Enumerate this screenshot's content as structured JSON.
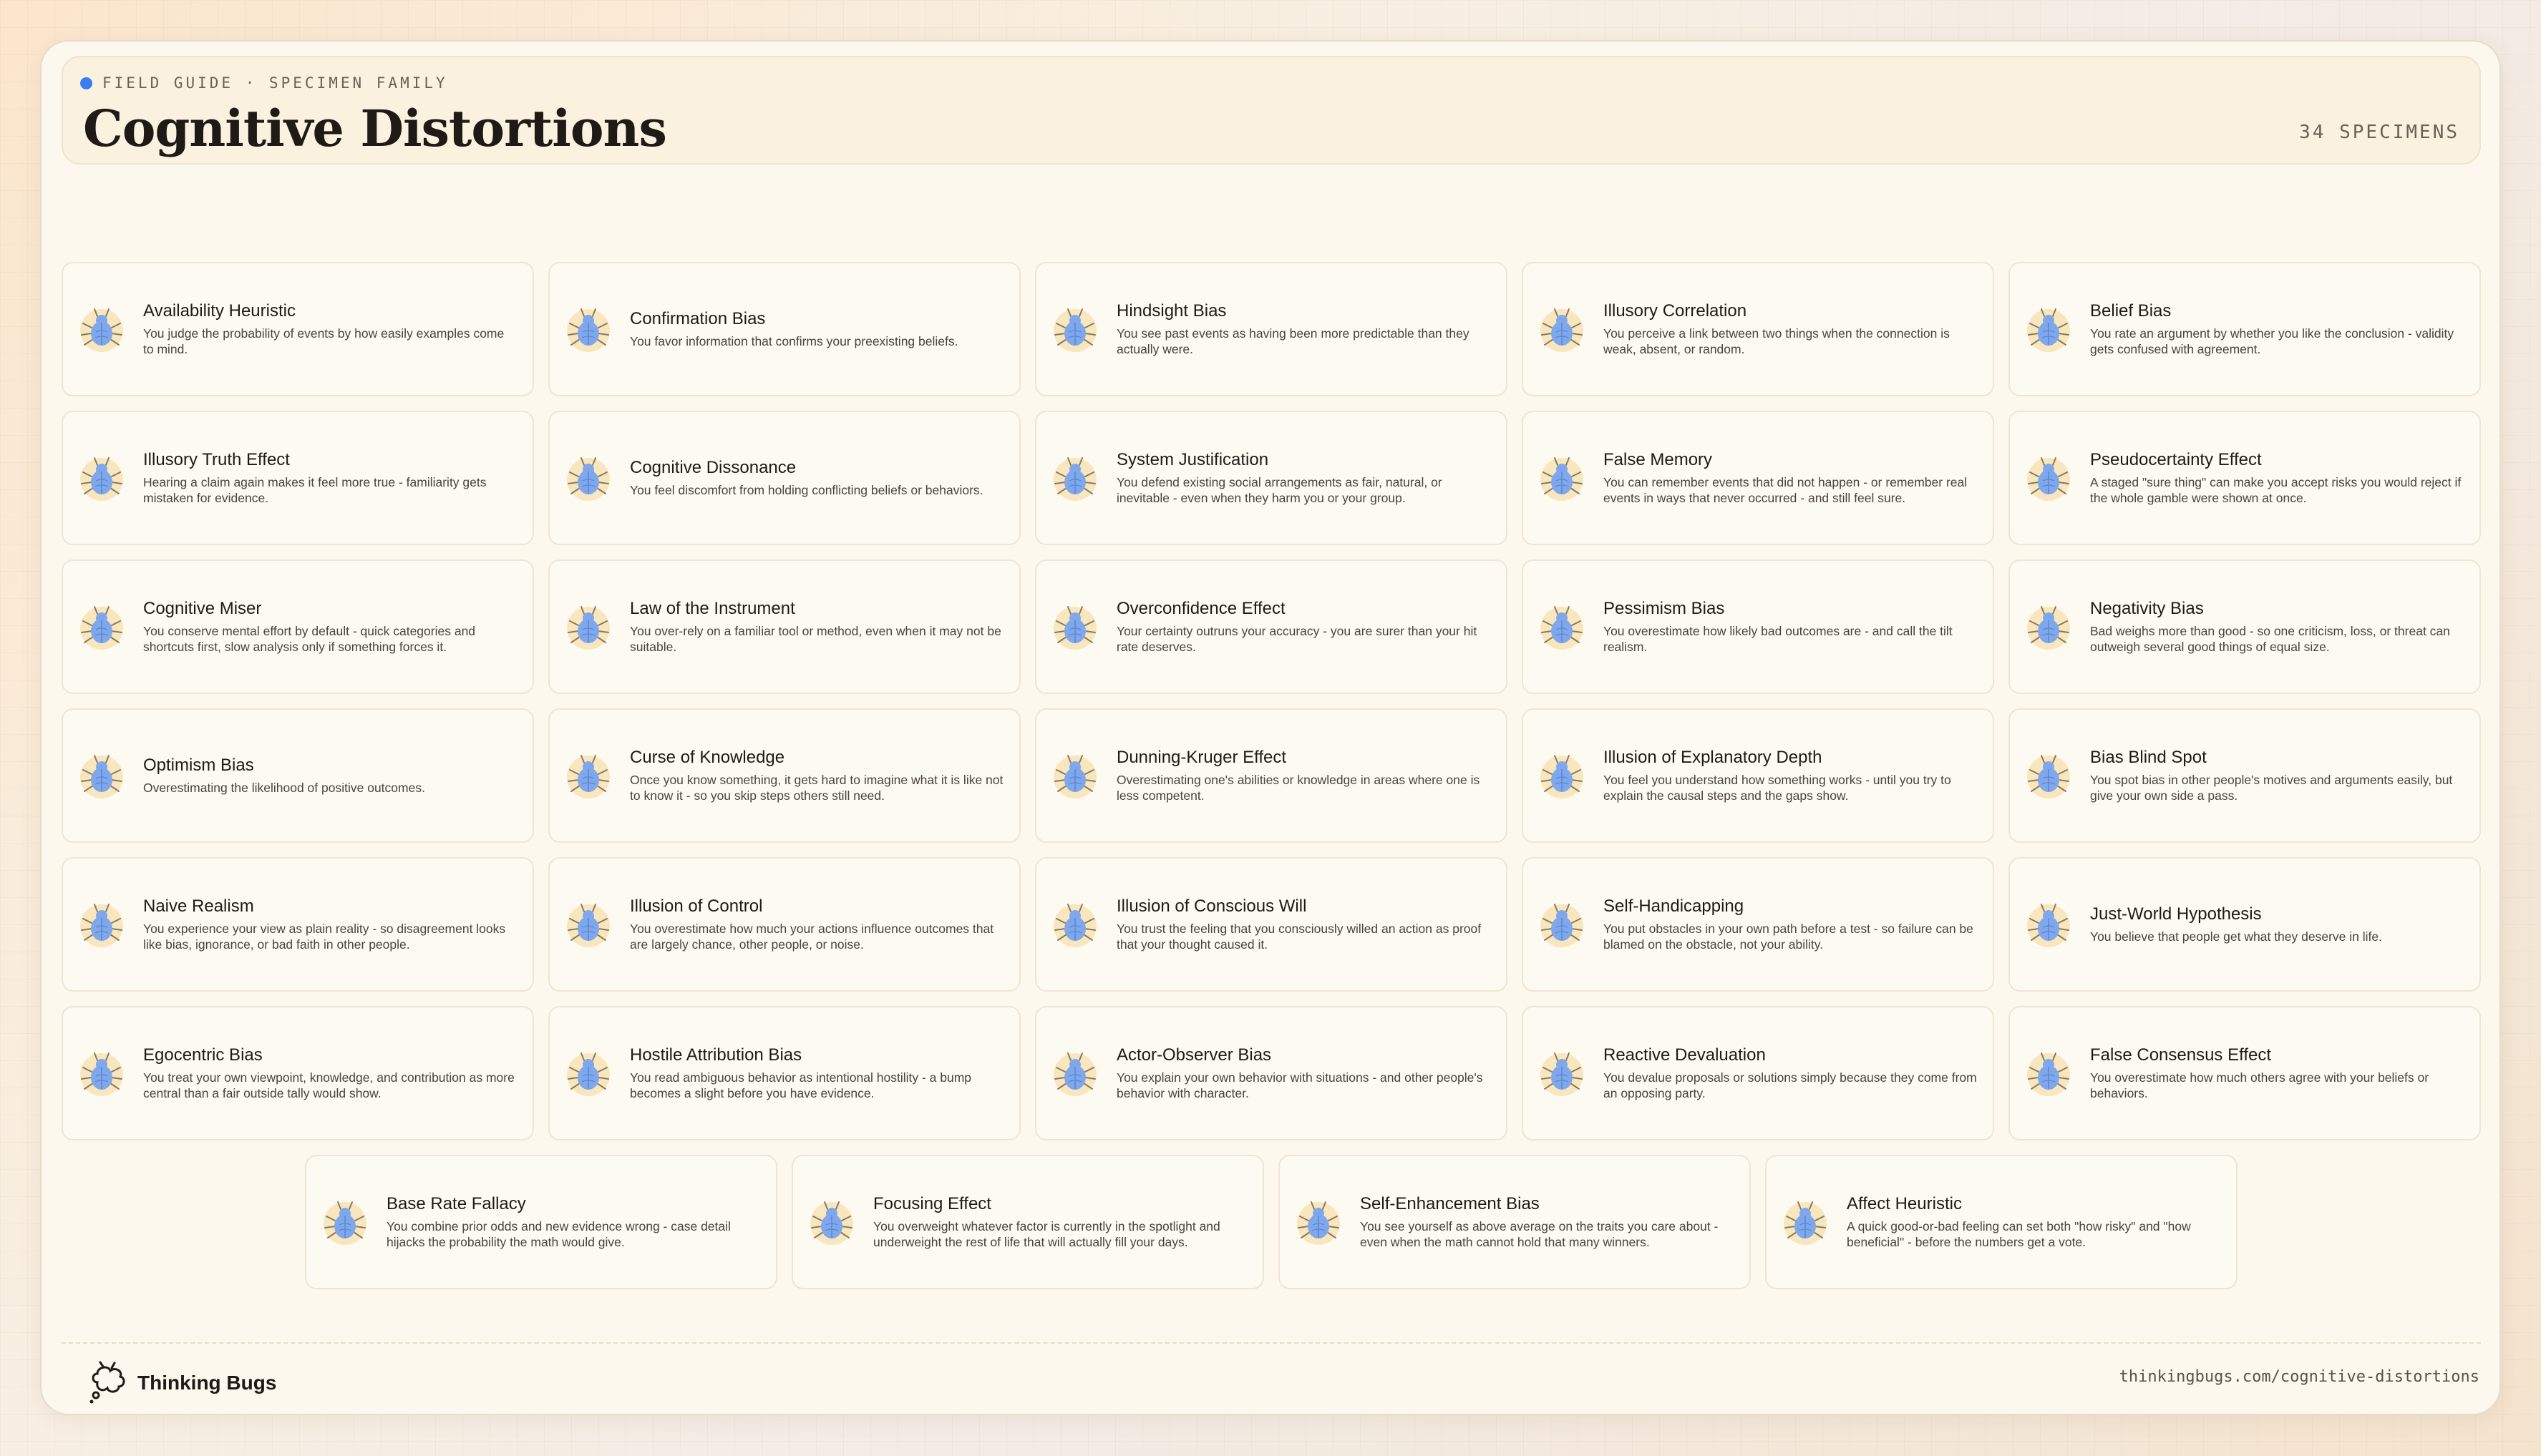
{
  "header": {
    "eyebrow": "FIELD GUIDE · SPECIMEN FAMILY",
    "title": "Cognitive Distortions",
    "count": "34 SPECIMENS",
    "accent_color": "#3a7cf2"
  },
  "specimens": [
    {
      "name": "Availability Heuristic",
      "description": "You judge the probability of events by how easily examples come to mind.",
      "icon": "bug-icon"
    },
    {
      "name": "Confirmation Bias",
      "description": "You favor information that confirms your preexisting beliefs.",
      "icon": "bug-icon"
    },
    {
      "name": "Hindsight Bias",
      "description": "You see past events as having been more predictable than they actually were.",
      "icon": "bug-icon"
    },
    {
      "name": "Illusory Correlation",
      "description": "You perceive a link between two things when the connection is weak, absent, or random.",
      "icon": "bug-icon"
    },
    {
      "name": "Belief Bias",
      "description": "You rate an argument by whether you like the conclusion - validity gets confused with agreement.",
      "icon": "bug-icon"
    },
    {
      "name": "Illusory Truth Effect",
      "description": "Hearing a claim again makes it feel more true - familiarity gets mistaken for evidence.",
      "icon": "bug-icon"
    },
    {
      "name": "Cognitive Dissonance",
      "description": "You feel discomfort from holding conflicting beliefs or behaviors.",
      "icon": "bug-icon"
    },
    {
      "name": "System Justification",
      "description": "You defend existing social arrangements as fair, natural, or inevitable - even when they harm you or your group.",
      "icon": "bug-icon"
    },
    {
      "name": "False Memory",
      "description": "You can remember events that did not happen - or remember real events in ways that never occurred - and still feel sure.",
      "icon": "bug-icon"
    },
    {
      "name": "Pseudocertainty Effect",
      "description": "A staged \"sure thing\" can make you accept risks you would reject if the whole gamble were shown at once.",
      "icon": "bug-icon"
    },
    {
      "name": "Cognitive Miser",
      "description": "You conserve mental effort by default - quick categories and shortcuts first, slow analysis only if something forces it.",
      "icon": "bug-icon"
    },
    {
      "name": "Law of the Instrument",
      "description": "You over-rely on a familiar tool or method, even when it may not be suitable.",
      "icon": "bug-icon"
    },
    {
      "name": "Overconfidence Effect",
      "description": "Your certainty outruns your accuracy - you are surer than your hit rate deserves.",
      "icon": "bug-icon"
    },
    {
      "name": "Pessimism Bias",
      "description": "You overestimate how likely bad outcomes are - and call the tilt realism.",
      "icon": "bug-icon"
    },
    {
      "name": "Negativity Bias",
      "description": "Bad weighs more than good - so one criticism, loss, or threat can outweigh several good things of equal size.",
      "icon": "bug-icon"
    },
    {
      "name": "Optimism Bias",
      "description": "Overestimating the likelihood of positive outcomes.",
      "icon": "bug-icon"
    },
    {
      "name": "Curse of Knowledge",
      "description": "Once you know something, it gets hard to imagine what it is like not to know it - so you skip steps others still need.",
      "icon": "bug-icon"
    },
    {
      "name": "Dunning-Kruger Effect",
      "description": "Overestimating one's abilities or knowledge in areas where one is less competent.",
      "icon": "bug-icon"
    },
    {
      "name": "Illusion of Explanatory Depth",
      "description": "You feel you understand how something works - until you try to explain the causal steps and the gaps show.",
      "icon": "bug-icon"
    },
    {
      "name": "Bias Blind Spot",
      "description": "You spot bias in other people's motives and arguments easily, but give your own side a pass.",
      "icon": "bug-icon"
    },
    {
      "name": "Naive Realism",
      "description": "You experience your view as plain reality - so disagreement looks like bias, ignorance, or bad faith in other people.",
      "icon": "bug-icon"
    },
    {
      "name": "Illusion of Control",
      "description": "You overestimate how much your actions influence outcomes that are largely chance, other people, or noise.",
      "icon": "bug-icon"
    },
    {
      "name": "Illusion of Conscious Will",
      "description": "You trust the feeling that you consciously willed an action as proof that your thought caused it.",
      "icon": "bug-icon"
    },
    {
      "name": "Self-Handicapping",
      "description": "You put obstacles in your own path before a test - so failure can be blamed on the obstacle, not your ability.",
      "icon": "bug-icon"
    },
    {
      "name": "Just-World Hypothesis",
      "description": "You believe that people get what they deserve in life.",
      "icon": "bug-icon"
    },
    {
      "name": "Egocentric Bias",
      "description": "You treat your own viewpoint, knowledge, and contribution as more central than a fair outside tally would show.",
      "icon": "bug-icon"
    },
    {
      "name": "Hostile Attribution Bias",
      "description": "You read ambiguous behavior as intentional hostility - a bump becomes a slight before you have evidence.",
      "icon": "bug-icon"
    },
    {
      "name": "Actor-Observer Bias",
      "description": "You explain your own behavior with situations - and other people's behavior with character.",
      "icon": "bug-icon"
    },
    {
      "name": "Reactive Devaluation",
      "description": "You devalue proposals or solutions simply because they come from an opposing party.",
      "icon": "bug-icon"
    },
    {
      "name": "False Consensus Effect",
      "description": "You overestimate how much others agree with your beliefs or behaviors.",
      "icon": "bug-icon"
    },
    {
      "name": "Base Rate Fallacy",
      "description": "You combine prior odds and new evidence wrong - case detail hijacks the probability the math would give.",
      "icon": "bug-icon"
    },
    {
      "name": "Focusing Effect",
      "description": "You overweight whatever factor is currently in the spotlight and underweight the rest of life that will actually fill your days.",
      "icon": "bug-icon"
    },
    {
      "name": "Self-Enhancement Bias",
      "description": "You see yourself as above average on the traits you care about - even when the math cannot hold that many winners.",
      "icon": "bug-icon"
    },
    {
      "name": "Affect Heuristic",
      "description": "A quick good-or-bad feeling can set both \"how risky\" and \"how beneficial\" - before the numbers get a vote.",
      "icon": "bug-icon"
    }
  ],
  "footer": {
    "brand": "Thinking Bugs",
    "brand_icon": "thinking-bug-logo-icon",
    "url": "thinkingbugs.com/cognitive-distortions"
  },
  "colors": {
    "bug_body": "#7fa8ec",
    "bug_glow": "#f8e6bf",
    "card_border": "#efe5d3"
  }
}
